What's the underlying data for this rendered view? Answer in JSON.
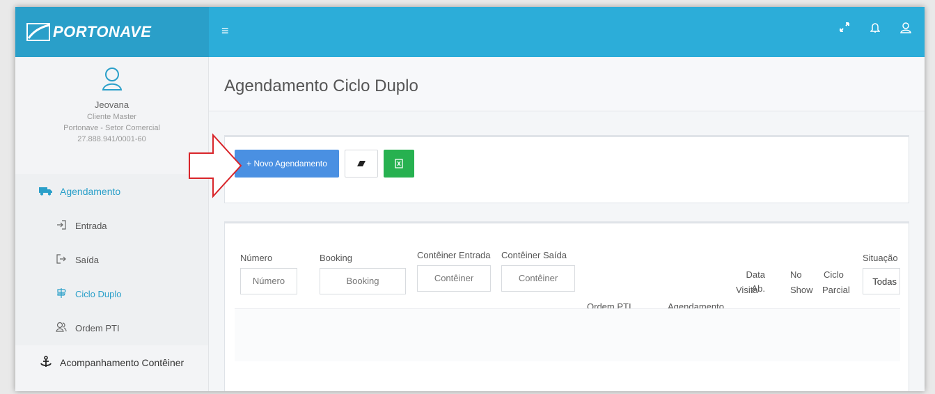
{
  "brand": {
    "name": "PORTONAVE",
    "menu_glyph": "≡"
  },
  "topbar": {
    "icons": [
      "expand-icon",
      "bell-icon",
      "user-icon"
    ],
    "accent": "#2cadd9"
  },
  "user": {
    "name": "Jeovana",
    "role": "Cliente Master",
    "company": "Portonave - Setor Comercial",
    "cnpj": "27.888.941/0001-60"
  },
  "sidebar": {
    "section": "Agendamento",
    "items": [
      {
        "label": "Entrada",
        "icon": "sign-in-icon"
      },
      {
        "label": "Saída",
        "icon": "sign-out-icon"
      },
      {
        "label": "Ciclo Duplo",
        "icon": "signpost-icon",
        "active": true
      },
      {
        "label": "Ordem PTI",
        "icon": "users-icon"
      }
    ],
    "bottom": "Acompanhamento Contêiner"
  },
  "page": {
    "title": "Agendamento Ciclo Duplo"
  },
  "actions": {
    "new_label": "+ Novo Agendamento",
    "clear_icon": "eraser-icon",
    "export_icon": "excel-icon"
  },
  "filters": {
    "numero": {
      "label": "Número",
      "placeholder": "Número"
    },
    "booking": {
      "label": "Booking",
      "placeholder": "Booking"
    },
    "entrada": {
      "label": "Contêiner Entrada",
      "placeholder": "Contêiner"
    },
    "saida": {
      "label": "Contêiner Saída",
      "placeholder": "Contêiner"
    },
    "situacao": {
      "label": "Situação",
      "value": "Todas"
    }
  },
  "columns": {
    "ordem_pti": "Ordem PTI",
    "agendamento": "Agendamento",
    "data_ab_1": "Data Ab.",
    "data_ab_2": "Visita",
    "no_show_1": "No",
    "no_show_2": "Show",
    "ciclo_1": "Ciclo",
    "ciclo_2": "Parcial"
  },
  "colors": {
    "primary": "#4a90e2",
    "excel": "#27b150",
    "arrow": "#d9252a"
  }
}
